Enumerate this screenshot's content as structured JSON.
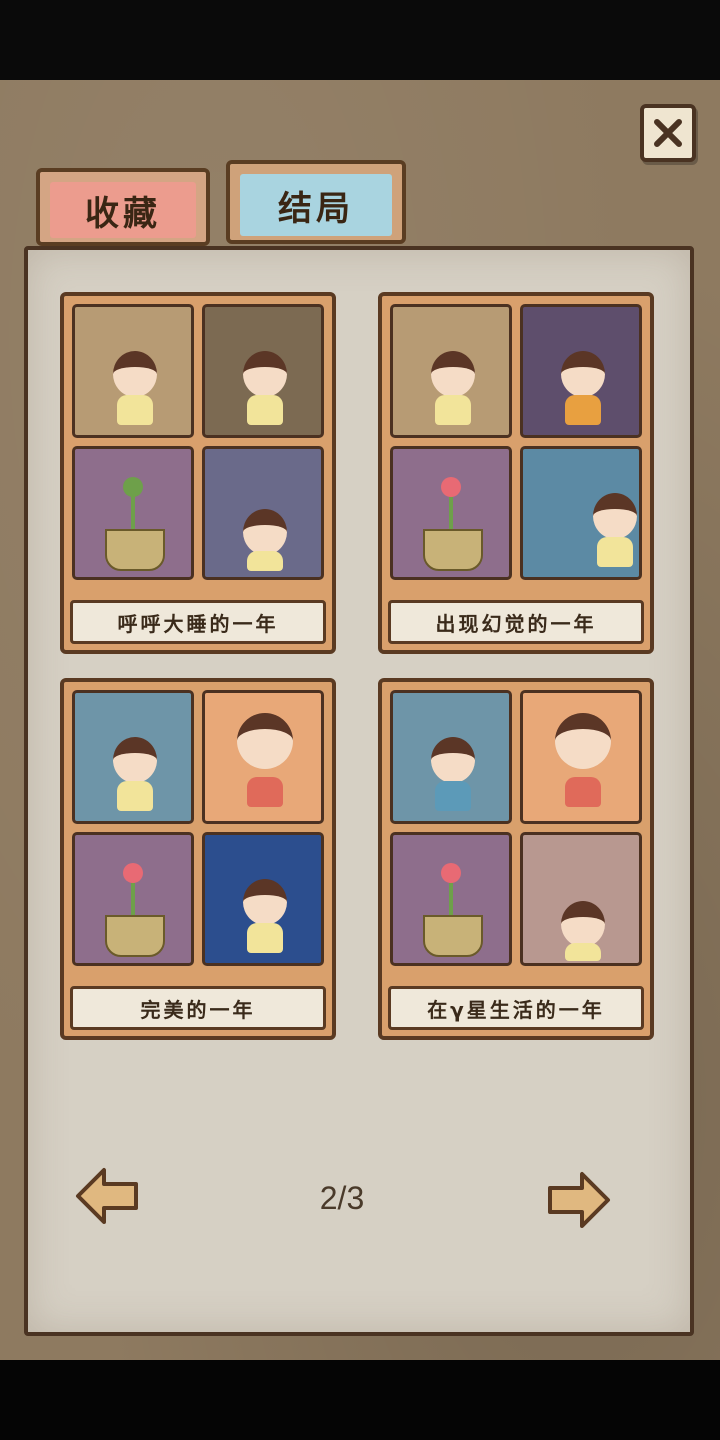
{
  "tabs": {
    "favorites_label": "收藏",
    "endings_label": "结局"
  },
  "endings": [
    {
      "title": "呼呼大睡的一年",
      "thumb_colors": [
        "#b79b74",
        "#7c6a52",
        "#8e6e8c",
        "#6a6a8a"
      ]
    },
    {
      "title": "出现幻觉的一年",
      "thumb_colors": [
        "#b79b74",
        "#5e4e6c",
        "#8e6e8c",
        "#5c8aa4"
      ]
    },
    {
      "title": "完美的一年",
      "thumb_colors": [
        "#6e95a8",
        "#e8a878",
        "#8e6e8c",
        "#2c4e8e"
      ]
    },
    {
      "title": "在γ星生活的一年",
      "thumb_colors": [
        "#6e95a8",
        "#e8a878",
        "#8e6e8c",
        "#b89890"
      ]
    }
  ],
  "pagination": {
    "current": "2/3"
  },
  "colors": {
    "background": "#8e7a60",
    "panel": "#d6d0c4",
    "card": "#d9a06c",
    "tab_favorites": "#ec9c8e",
    "tab_endings": "#a9d4e0"
  }
}
